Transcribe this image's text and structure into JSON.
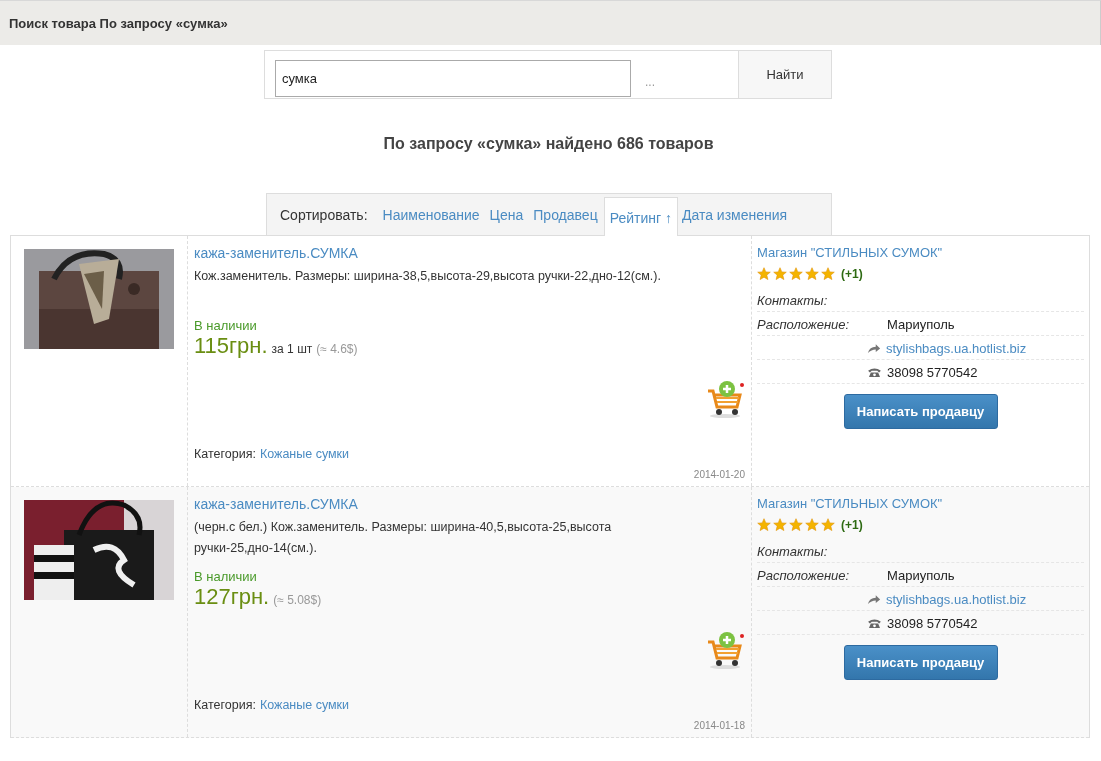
{
  "header": {
    "title": "Поиск товара По запросу «сумка»"
  },
  "search": {
    "value": "сумка",
    "more": "...",
    "button": "Найти"
  },
  "result_heading": "По запросу «сумка» найдено 686 товаров",
  "sort": {
    "label": "Сортировать:",
    "options": [
      {
        "label": "Наименование",
        "selected": false
      },
      {
        "label": "Цена",
        "selected": false
      },
      {
        "label": "Продавец",
        "selected": false
      },
      {
        "label": "Рейтинг ↑",
        "selected": true
      },
      {
        "label": "Дата изменения",
        "selected": false
      }
    ]
  },
  "products": [
    {
      "title": "кажа-заменитель.СУМКА",
      "description": "Кож.заменитель. Размеры: ширина-38,5,высота-29,высота ручки-22,дно-12(см.).",
      "availability": "В наличии",
      "price": "115грн.",
      "unit": "за 1 шт",
      "price_usd": "(≈ 4.6$)",
      "category_label": "Категория:",
      "category": "Кожаные сумки",
      "date": "2014-01-20",
      "shop": {
        "name": "Магазин \"СТИЛЬНЫХ СУМОК\"",
        "stars": 5,
        "rating": "(+1)",
        "contacts_label": "Контакты:",
        "location_label": "Расположение:",
        "location": "Мариуполь",
        "website": "stylishbags.ua.hotlist.biz",
        "phone": "38098 5770542",
        "button": "Написать продавцу"
      }
    },
    {
      "title": "кажа-заменитель.СУМКА",
      "description": "(черн.с бел.) Кож.заменитель. Размеры: ширина-40,5,высота-25,высота ручки-25,дно-14(см.).",
      "availability": "В наличии",
      "price": "127грн.",
      "price_usd": "(≈ 5.08$)",
      "category_label": "Категория:",
      "category": "Кожаные сумки",
      "date": "2014-01-18",
      "shop": {
        "name": "Магазин \"СТИЛЬНЫХ СУМОК\"",
        "stars": 5,
        "rating": "(+1)",
        "contacts_label": "Контакты:",
        "location_label": "Расположение:",
        "location": "Мариуполь",
        "website": "stylishbags.ua.hotlist.biz",
        "phone": "38098 5770542",
        "button": "Написать продавцу"
      }
    }
  ]
}
